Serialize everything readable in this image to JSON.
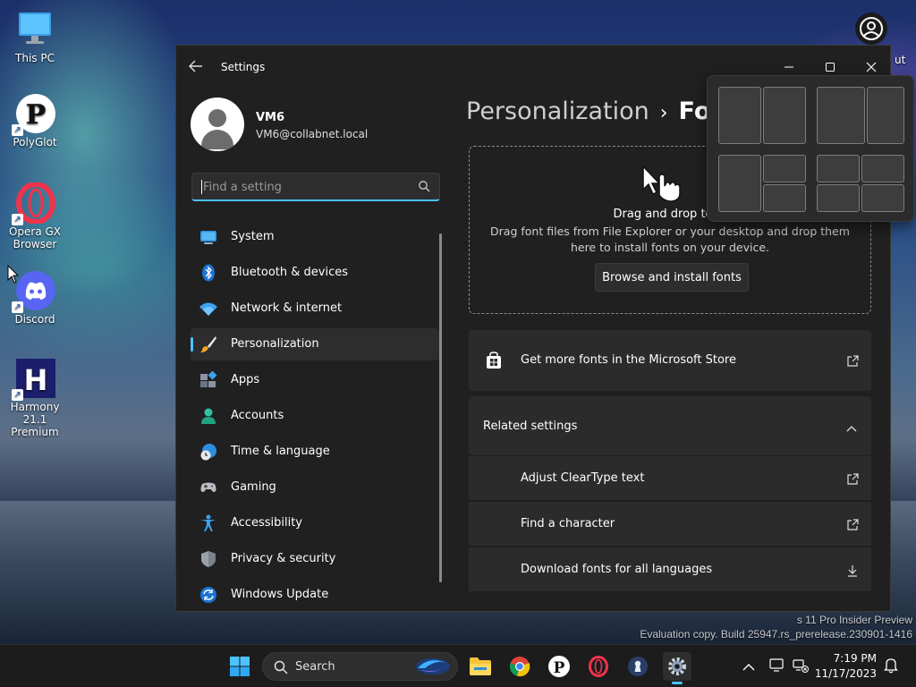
{
  "desktop": {
    "icons": [
      {
        "label": "This PC",
        "icon": "monitor-icon"
      },
      {
        "label": "PolyGlot",
        "icon": "polyglot-icon"
      },
      {
        "label": "Opera GX Browser",
        "icon": "opera-gx-icon"
      },
      {
        "label": "Discord",
        "icon": "discord-icon"
      },
      {
        "label": "Harmony 21.1 Premium",
        "icon": "harmony-icon"
      }
    ],
    "corner_text": "ut",
    "watermark": {
      "line1": "s 11 Pro Insider Preview",
      "line2": "Evaluation copy. Build 25947.rs_prerelease.230901-1416"
    }
  },
  "window": {
    "title": "Settings",
    "controls": {
      "minimize": "—",
      "maximize": "☐",
      "close": "✕"
    }
  },
  "profile": {
    "name": "VM6",
    "email": "VM6@collabnet.local"
  },
  "search": {
    "placeholder": "Find a setting"
  },
  "nav": {
    "items": [
      {
        "label": "System",
        "icon": "system-icon"
      },
      {
        "label": "Bluetooth & devices",
        "icon": "bluetooth-icon"
      },
      {
        "label": "Network & internet",
        "icon": "wifi-icon"
      },
      {
        "label": "Personalization",
        "icon": "brush-icon",
        "active": true
      },
      {
        "label": "Apps",
        "icon": "apps-icon"
      },
      {
        "label": "Accounts",
        "icon": "accounts-icon"
      },
      {
        "label": "Time & language",
        "icon": "clock-globe-icon"
      },
      {
        "label": "Gaming",
        "icon": "gamepad-icon"
      },
      {
        "label": "Accessibility",
        "icon": "accessibility-icon"
      },
      {
        "label": "Privacy & security",
        "icon": "shield-icon"
      },
      {
        "label": "Windows Update",
        "icon": "update-icon"
      }
    ]
  },
  "breadcrumb": {
    "parent": "Personalization",
    "separator": "›",
    "current": "Fo"
  },
  "drop_zone": {
    "title": "Drag and drop to in",
    "description": "Drag font files from File Explorer or your desktop and drop them here to install fonts on your device.",
    "button": "Browse and install fonts"
  },
  "store_card": {
    "label": "Get more fonts in the Microsoft Store"
  },
  "related": {
    "header": "Related settings",
    "items": [
      {
        "label": "Adjust ClearType text",
        "action": "external-link-icon"
      },
      {
        "label": "Find a character",
        "action": "external-link-icon"
      },
      {
        "label": "Download fonts for all languages",
        "action": "download-icon"
      }
    ]
  },
  "taskbar": {
    "search_label": "Search",
    "time": "7:19 PM",
    "date": "11/17/2023"
  },
  "colors": {
    "accent": "#4cc2ff",
    "window_bg": "#202020",
    "card_bg": "#2b2b2b"
  }
}
